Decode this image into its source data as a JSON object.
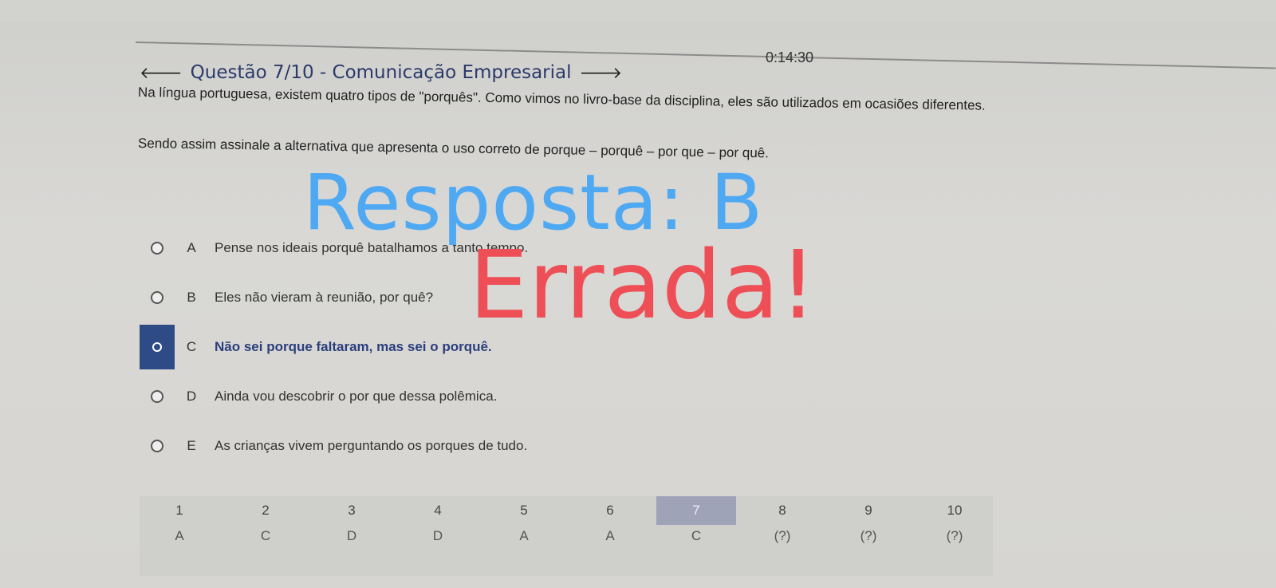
{
  "timer": "0:14:30",
  "question": {
    "title": "Questão 7/10 - Comunicação Empresarial",
    "prev_icon": "arrow-left-icon",
    "next_icon": "arrow-right-icon",
    "text1": "Na língua portuguesa, existem quatro tipos de \"porquês\". Como vimos no livro-base da disciplina, eles são utilizados em ocasiões diferentes.",
    "text2": "Sendo assim assinale a alternativa que apresenta o uso correto de porque – porquê – por que – por quê."
  },
  "options": [
    {
      "letter": "A",
      "text": "Pense nos ideais porquê batalhamos a tanto tempo.",
      "selected": false
    },
    {
      "letter": "B",
      "text": "Eles não vieram à reunião, por quê?",
      "selected": false
    },
    {
      "letter": "C",
      "text": "Não sei porque faltaram, mas sei o porquê.",
      "selected": true
    },
    {
      "letter": "D",
      "text": "Ainda vou descobrir o por que dessa polêmica.",
      "selected": false
    },
    {
      "letter": "E",
      "text": "As crianças vivem perguntando os porques de tudo.",
      "selected": false
    }
  ],
  "overlay": {
    "answer": "Resposta: B",
    "verdict": "Errada!"
  },
  "navigation": [
    {
      "num": "1",
      "answer": "A"
    },
    {
      "num": "2",
      "answer": "C"
    },
    {
      "num": "3",
      "answer": "D"
    },
    {
      "num": "4",
      "answer": "D"
    },
    {
      "num": "5",
      "answer": "A"
    },
    {
      "num": "6",
      "answer": "A"
    },
    {
      "num": "7",
      "answer": "C",
      "current": true
    },
    {
      "num": "8",
      "answer": "(?)"
    },
    {
      "num": "9",
      "answer": "(?)"
    },
    {
      "num": "10",
      "answer": "(?)"
    }
  ],
  "colors": {
    "selected_bg": "#2f4b86",
    "answer_overlay": "#4ea9f2",
    "verdict_overlay": "#ee4f57",
    "current_nav_bg": "#9fa3b8"
  }
}
